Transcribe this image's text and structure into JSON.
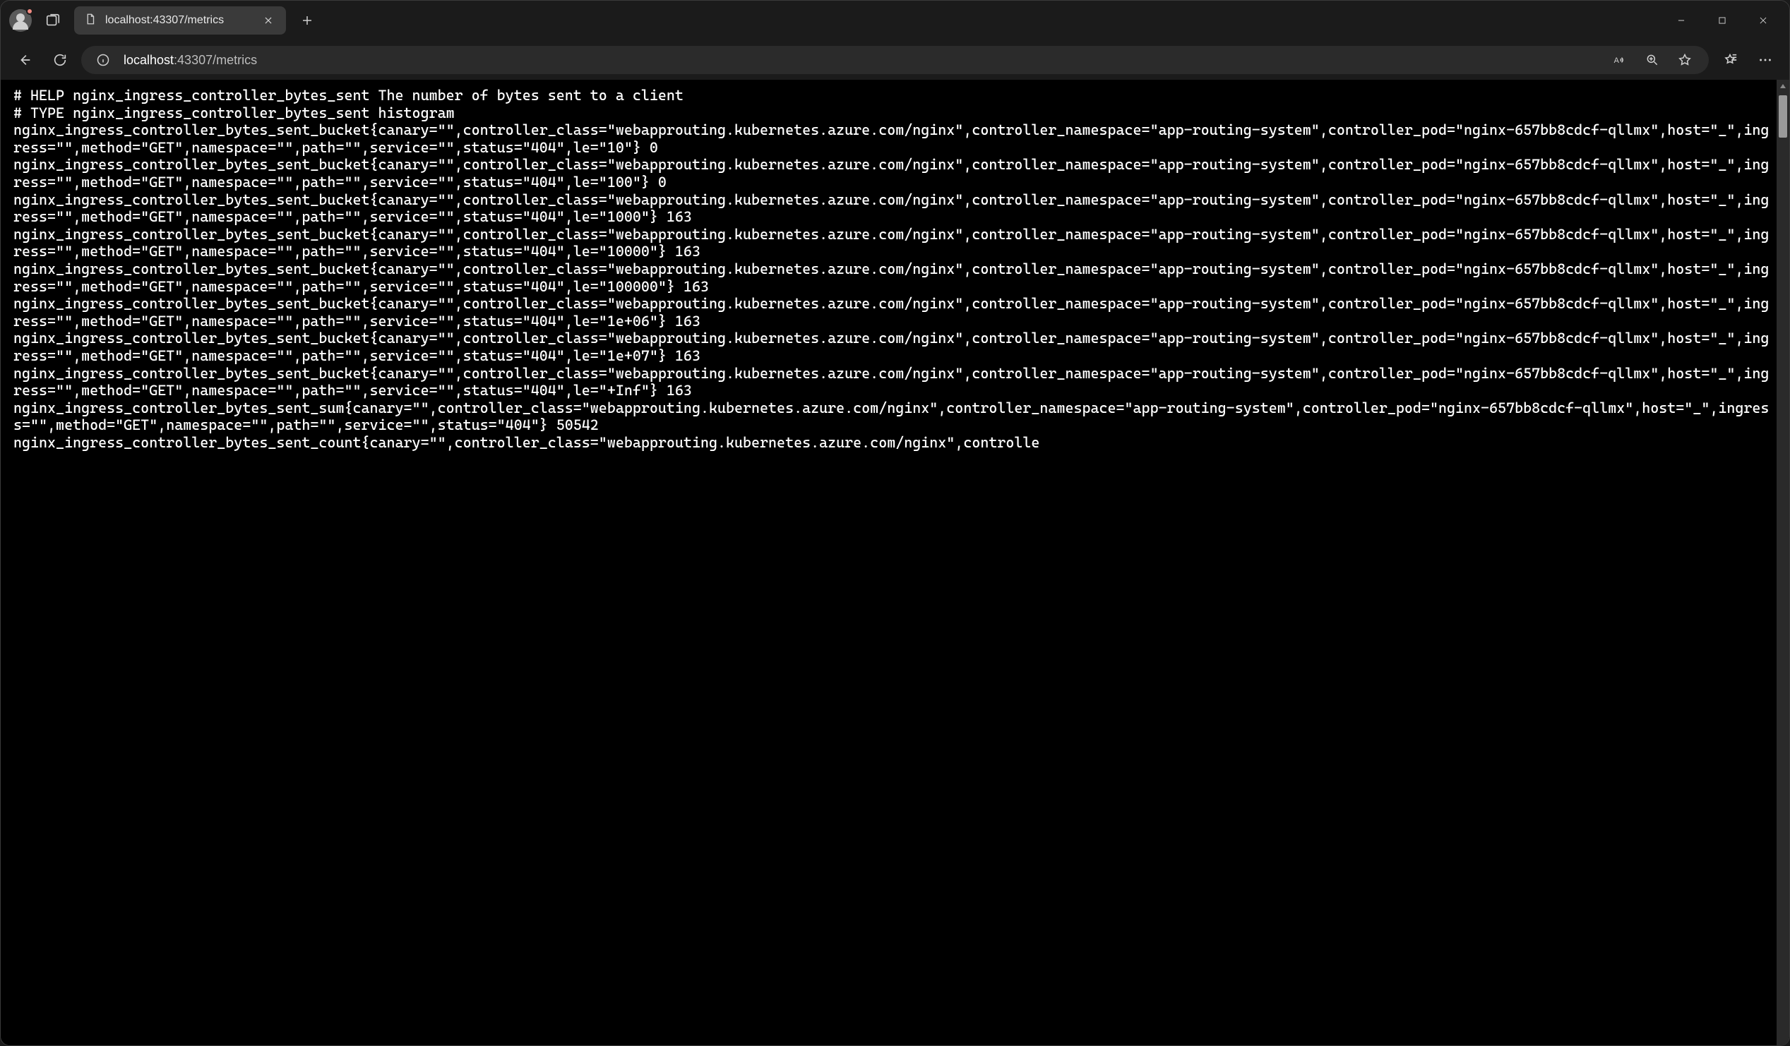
{
  "tab": {
    "title": "localhost:43307/metrics"
  },
  "address": {
    "host": "localhost",
    "path": ":43307/metrics"
  },
  "metrics": {
    "metric_name": "nginx_ingress_controller_bytes_sent",
    "help_line": "# HELP nginx_ingress_controller_bytes_sent The number of bytes sent to a client",
    "type_line": "# TYPE nginx_ingress_controller_bytes_sent histogram",
    "common_labels": {
      "canary": "",
      "controller_class": "webapprouting.kubernetes.azure.com/nginx",
      "controller_namespace": "app-routing-system",
      "controller_pod": "nginx-657bb8cdcf-qllmx",
      "host": "_",
      "ingress": "",
      "method": "GET",
      "namespace": "",
      "path": "",
      "service": "",
      "status": "404"
    },
    "buckets": [
      {
        "le": "10",
        "value": 0
      },
      {
        "le": "100",
        "value": 0
      },
      {
        "le": "1000",
        "value": 163
      },
      {
        "le": "10000",
        "value": 163
      },
      {
        "le": "100000",
        "value": 163
      },
      {
        "le": "1e+06",
        "value": 163
      },
      {
        "le": "1e+07",
        "value": 163
      },
      {
        "le": "+Inf",
        "value": 163
      }
    ],
    "sum": 50542,
    "count_line_prefix": "nginx_ingress_controller_bytes_sent_count{canary=\"\",controller_class=\"webapprouting.kubernetes.azure.com/nginx\",controlle"
  }
}
